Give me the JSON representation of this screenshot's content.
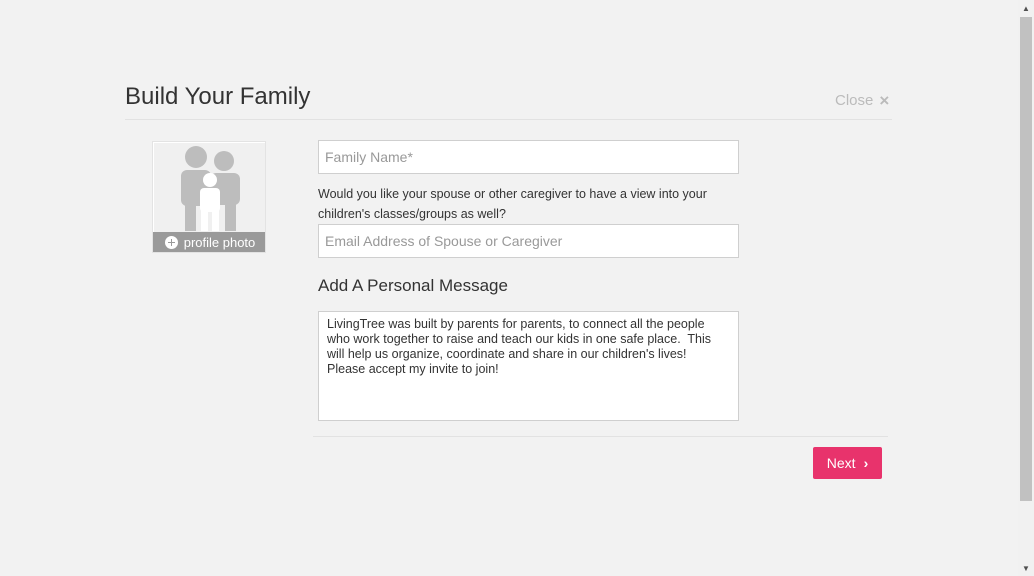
{
  "modal": {
    "title": "Build Your Family",
    "close_label": "Close",
    "close_icon": "×"
  },
  "profile": {
    "label": "profile photo"
  },
  "form": {
    "family_name_placeholder": "Family Name*",
    "question": "Would you like your spouse or other caregiver to have a view into your children's classes/groups as well?",
    "email_placeholder": "Email Address of Spouse or Caregiver",
    "message_heading": "Add A Personal Message",
    "message_text": "LivingTree was built by parents for parents, to connect all the people who work together to raise and teach our kids in one safe place.  This will help us organize, coordinate and share in our children's lives!  Please accept my invite to join!"
  },
  "footer": {
    "next_label": "Next",
    "next_icon": "›"
  },
  "colors": {
    "accent": "#e8336c",
    "background": "#f2f2f2"
  }
}
